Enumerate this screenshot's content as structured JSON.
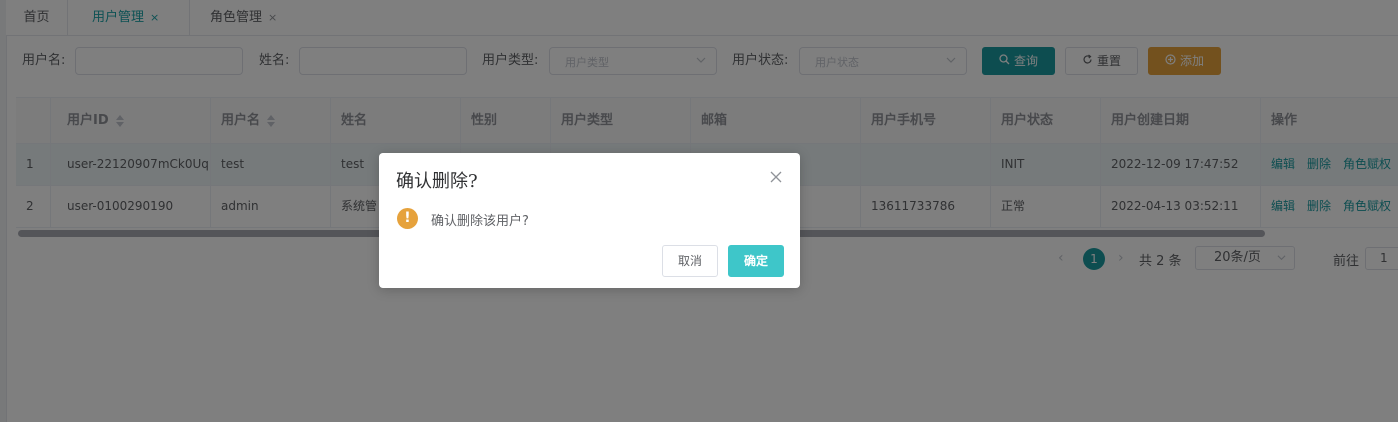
{
  "tabs": [
    {
      "label": "首页",
      "closable": false
    },
    {
      "label": "用户管理",
      "closable": true,
      "active": true
    },
    {
      "label": "角色管理",
      "closable": true
    }
  ],
  "tab_close_glyph": "×",
  "filters": {
    "username_label": "用户名:",
    "name_label": "姓名:",
    "user_type_label": "用户类型:",
    "user_type_placeholder": "用户类型",
    "user_status_label": "用户状态:",
    "user_status_placeholder": "用户状态"
  },
  "buttons": {
    "search": "查询",
    "reset": "重置",
    "add": "添加"
  },
  "table": {
    "columns": [
      "",
      "用户ID",
      "用户名",
      "姓名",
      "性别",
      "用户类型",
      "邮箱",
      "用户手机号",
      "用户状态",
      "用户创建日期",
      "操作"
    ],
    "rows": [
      {
        "index": "1",
        "user_id": "user-22120907mCk0Uq",
        "username": "test",
        "name": "test",
        "gender": "",
        "user_type": "",
        "email": "",
        "phone": "",
        "status": "INIT",
        "created": "2022-12-09 17:47:52",
        "actions": [
          "编辑",
          "删除",
          "角色赋权"
        ]
      },
      {
        "index": "2",
        "user_id": "user-0100290190",
        "username": "admin",
        "name": "系统管",
        "gender": "",
        "user_type": "",
        "email": "",
        "phone": "13611733786",
        "status": "正常",
        "created": "2022-04-13 03:52:11",
        "actions": [
          "编辑",
          "删除",
          "角色赋权"
        ]
      }
    ]
  },
  "pagination": {
    "current_page": "1",
    "total": "共 2 条",
    "page_size": "20条/页",
    "goto_label": "前往",
    "goto_value": "1"
  },
  "dialog": {
    "title": "确认删除?",
    "message": "确认删除该用户?",
    "warning_glyph": "!",
    "cancel": "取消",
    "confirm": "确定"
  },
  "colors": {
    "primary": "#1a9ba1",
    "confirm": "#3ec6c9",
    "warning": "#e6a23c"
  }
}
